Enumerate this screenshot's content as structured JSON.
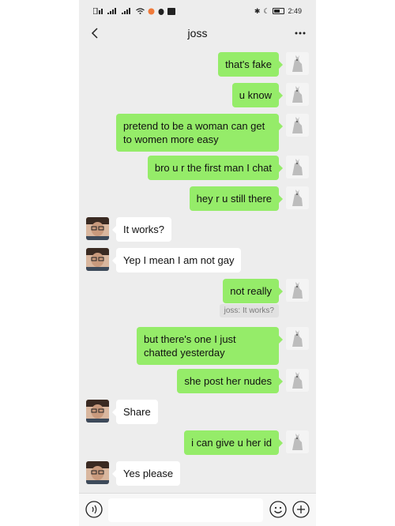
{
  "status_bar": {
    "left_text": "□³ᴲᴵᴵ ᴴᴵᴵ",
    "time": "2:49"
  },
  "header": {
    "title": "joss",
    "more_label": "···"
  },
  "messages": [
    {
      "side": "me",
      "text": "that's fake"
    },
    {
      "side": "me",
      "text": "u know"
    },
    {
      "side": "me",
      "text": "pretend to be a woman can get to women more easy"
    },
    {
      "side": "me",
      "text": "bro u r the first man I chat"
    },
    {
      "side": "me",
      "text": "hey r u still there"
    },
    {
      "side": "them",
      "text": "It works?"
    },
    {
      "side": "them",
      "text": "Yep I mean I am not gay"
    },
    {
      "side": "me",
      "text": "not really"
    },
    {
      "side": "quote",
      "text": "joss: It works?"
    },
    {
      "side": "me",
      "text": "but there's one I just chatted yesterday"
    },
    {
      "side": "me",
      "text": "she post her nudes"
    },
    {
      "side": "them",
      "text": "Share"
    },
    {
      "side": "me",
      "text": "i can give u her id"
    },
    {
      "side": "them",
      "text": "Yes please"
    }
  ],
  "input": {
    "value": "",
    "placeholder": ""
  },
  "icons": {
    "back": "chevron-left-icon",
    "voice": "voice-icon",
    "emoji": "emoji-icon",
    "plus": "plus-icon"
  },
  "colors": {
    "my_bubble": "#95ec69",
    "their_bubble": "#ffffff",
    "chat_background": "#ededed"
  }
}
